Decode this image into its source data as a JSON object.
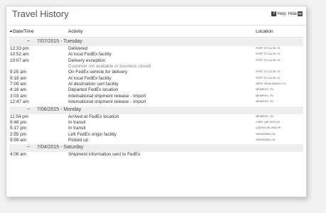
{
  "panel": {
    "title": "Travel History",
    "help_label": "Help",
    "hide_label": "Hide",
    "help_glyph": "?"
  },
  "columns": {
    "date_time": "Date/Time",
    "activity": "Activity",
    "location": "Location"
  },
  "groups": [
    {
      "date": "7/07/2015 - Tuesday",
      "rows": [
        {
          "time": "12:33 pm",
          "activity": "Delivered",
          "location": "PORT ST LUCIE, FL"
        },
        {
          "time": "10:52 am",
          "activity": "At local FedEx facility",
          "location": "PORT ST LUCIE, FL"
        },
        {
          "time": "10:07 am",
          "activity": "Delivery exception",
          "location": "PORT ST LUCIE, FL",
          "note": "Customer not available or business closed"
        },
        {
          "time": "9:25 am",
          "activity": "On FedEx vehicle for delivery",
          "location": "PORT ST LUCIE, FL"
        },
        {
          "time": "9:19 am",
          "activity": "At local FedEx facility",
          "location": "PORT ST LUCIE, FL"
        },
        {
          "time": "7:09 am",
          "activity": "At destination sort facility",
          "location": "WEST PALM BEACH, FL"
        },
        {
          "time": "4:16 am",
          "activity": "Departed FedEx location",
          "location": "MEMPHIS, TN"
        },
        {
          "time": "3:03 am",
          "activity": "International shipment release - Import",
          "location": "MEMPHIS, TN"
        },
        {
          "time": "12:47 am",
          "activity": "International shipment release - Import",
          "location": "MEMPHIS, TN"
        }
      ]
    },
    {
      "date": "7/06/2015 - Monday",
      "rows": [
        {
          "time": "11:54 pm",
          "activity": "Arrived at FedEx location",
          "location": "MEMPHIS, TN"
        },
        {
          "time": "9:48 pm",
          "activity": "In transit",
          "location": "CHEK LAP KOK HK"
        },
        {
          "time": "5:17 pm",
          "activity": "In transit",
          "location": "LANTAU ISLAND HK"
        },
        {
          "time": "2:55 pm",
          "activity": "Left FedEx origin facility",
          "location": "SHENZHEN CN"
        },
        {
          "time": "9:59 am",
          "activity": "Picked up",
          "location": "SHENZHEN CN"
        }
      ]
    },
    {
      "date": "7/04/2015 - Saturday",
      "rows": [
        {
          "time": "4:08 am",
          "activity": "Shipment information sent to FedEx",
          "location": ""
        }
      ]
    }
  ]
}
